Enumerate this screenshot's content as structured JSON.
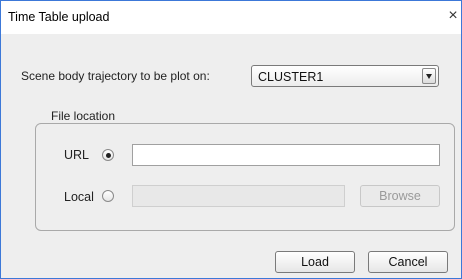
{
  "window": {
    "title": "Time Table upload",
    "close_glyph": "×"
  },
  "scene": {
    "label": "Scene body trajectory to be plot on:",
    "selected": "CLUSTER1"
  },
  "file_location": {
    "group_label": "File location",
    "url_label": "URL",
    "url_selected": true,
    "url_value": "",
    "local_label": "Local",
    "local_selected": false,
    "local_value": "",
    "browse_label": "Browse"
  },
  "actions": {
    "load_label": "Load",
    "cancel_label": "Cancel"
  },
  "colors": {
    "window_border": "#3c78d8",
    "dialog_bg": "#eeeeee"
  }
}
